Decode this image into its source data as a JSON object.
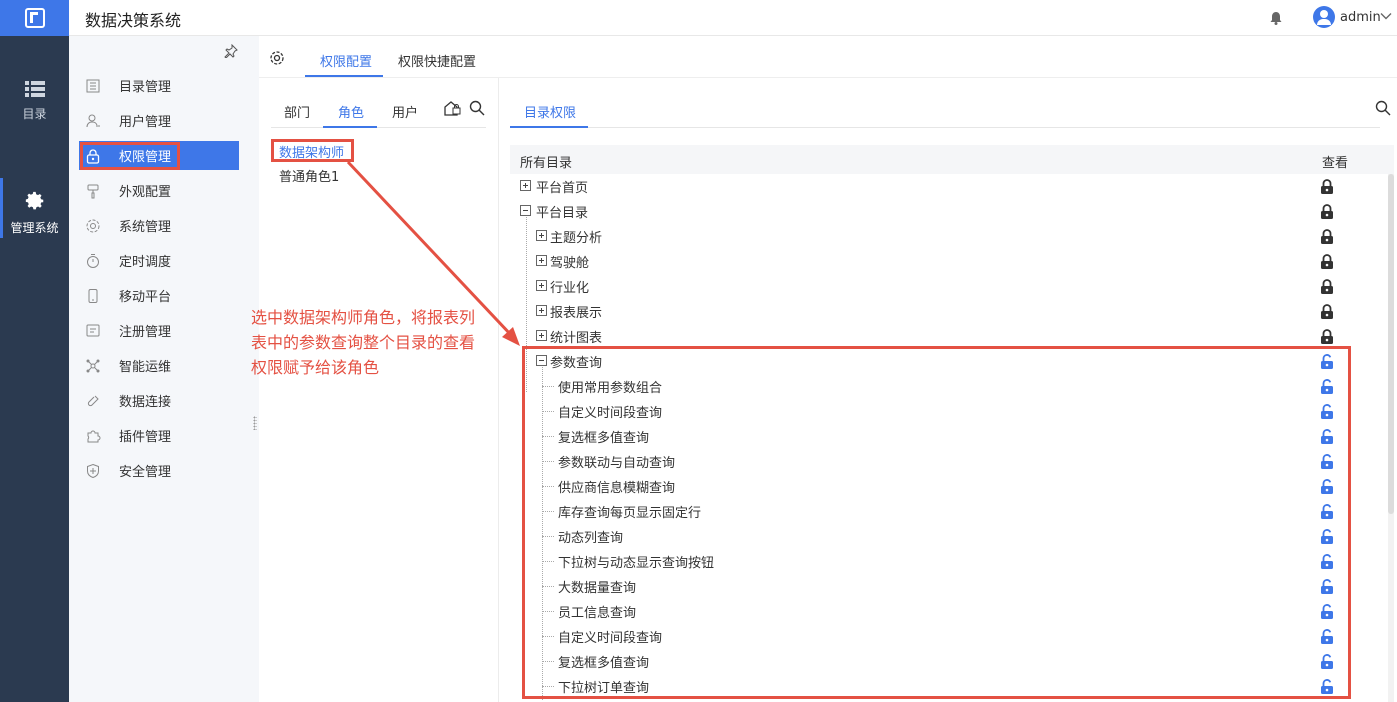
{
  "app": {
    "title": "数据决策系统",
    "user": "admin"
  },
  "left_nav": [
    {
      "label": "目录",
      "icon": "list-icon"
    },
    {
      "label": "管理系统",
      "icon": "gear-icon",
      "active": true
    }
  ],
  "menu": {
    "items": [
      {
        "label": "目录管理",
        "icon": "catalog-icon"
      },
      {
        "label": "用户管理",
        "icon": "user-icon"
      },
      {
        "label": "权限管理",
        "icon": "lock-icon",
        "active": true
      },
      {
        "label": "外观配置",
        "icon": "brush-icon"
      },
      {
        "label": "系统管理",
        "icon": "settings-icon"
      },
      {
        "label": "定时调度",
        "icon": "timer-icon"
      },
      {
        "label": "移动平台",
        "icon": "mobile-icon"
      },
      {
        "label": "注册管理",
        "icon": "register-icon"
      },
      {
        "label": "智能运维",
        "icon": "ops-icon"
      },
      {
        "label": "数据连接",
        "icon": "link-icon"
      },
      {
        "label": "插件管理",
        "icon": "plugin-icon"
      },
      {
        "label": "安全管理",
        "icon": "shield-icon"
      }
    ]
  },
  "top_tabs": [
    {
      "label": "权限配置",
      "active": true
    },
    {
      "label": "权限快捷配置"
    }
  ],
  "sub_tabs": [
    {
      "label": "部门"
    },
    {
      "label": "角色",
      "active": true
    },
    {
      "label": "用户"
    }
  ],
  "roles": [
    {
      "label": "数据架构师",
      "selected": true
    },
    {
      "label": "普通角色1"
    }
  ],
  "right_tab": "目录权限",
  "tree": {
    "header_name": "所有目录",
    "header_view": "查看",
    "rows": [
      {
        "label": "平台首页",
        "level": 0,
        "expander": "plus",
        "lock": "locked"
      },
      {
        "label": "平台目录",
        "level": 0,
        "expander": "minus",
        "lock": "locked"
      },
      {
        "label": "主题分析",
        "level": 1,
        "expander": "plus",
        "lock": "locked"
      },
      {
        "label": "驾驶舱",
        "level": 1,
        "expander": "plus",
        "lock": "locked"
      },
      {
        "label": "行业化",
        "level": 1,
        "expander": "plus",
        "lock": "locked"
      },
      {
        "label": "报表展示",
        "level": 1,
        "expander": "plus",
        "lock": "locked"
      },
      {
        "label": "统计图表",
        "level": 1,
        "expander": "plus",
        "lock": "locked"
      },
      {
        "label": "参数查询",
        "level": 1,
        "expander": "minus",
        "lock": "unlocked"
      },
      {
        "label": "使用常用参数组合",
        "level": 2,
        "lock": "unlocked"
      },
      {
        "label": "自定义时间段查询",
        "level": 2,
        "lock": "unlocked"
      },
      {
        "label": "复选框多值查询",
        "level": 2,
        "lock": "unlocked"
      },
      {
        "label": "参数联动与自动查询",
        "level": 2,
        "lock": "unlocked"
      },
      {
        "label": "供应商信息模糊查询",
        "level": 2,
        "lock": "unlocked"
      },
      {
        "label": "库存查询每页显示固定行",
        "level": 2,
        "lock": "unlocked"
      },
      {
        "label": "动态列查询",
        "level": 2,
        "lock": "unlocked"
      },
      {
        "label": "下拉树与动态显示查询按钮",
        "level": 2,
        "lock": "unlocked"
      },
      {
        "label": "大数据量查询",
        "level": 2,
        "lock": "unlocked"
      },
      {
        "label": "员工信息查询",
        "level": 2,
        "lock": "unlocked"
      },
      {
        "label": "自定义时间段查询",
        "level": 2,
        "lock": "unlocked"
      },
      {
        "label": "复选框多值查询",
        "level": 2,
        "lock": "unlocked"
      },
      {
        "label": "下拉树订单查询",
        "level": 2,
        "lock": "unlocked"
      }
    ]
  },
  "annotation": "选中数据架构师角色，将报表列表中的参数查询整个目录的查看权限赋予给该角色",
  "colors": {
    "accent": "#3e77e8",
    "annotation": "#e45143",
    "nav_bg": "#2b3a50",
    "locked": "#333333",
    "unlocked": "#3e77e8"
  }
}
